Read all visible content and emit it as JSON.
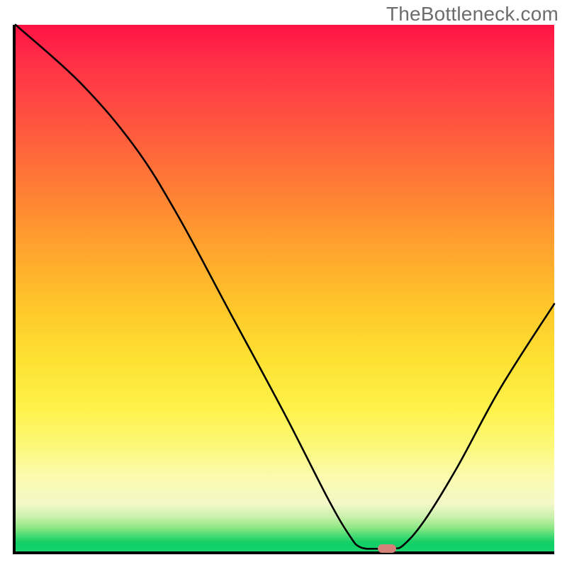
{
  "watermark": "TheBottleneck.com",
  "colors": {
    "axis": "#000000",
    "curve": "#000000",
    "marker": "#d58079",
    "gradient_top": "#ff1244",
    "gradient_bottom": "#18d66d"
  },
  "chart_data": {
    "type": "line",
    "title": "",
    "xlabel": "",
    "ylabel": "",
    "xlim": [
      0,
      100
    ],
    "ylim": [
      0,
      100
    ],
    "grid": false,
    "curve_points": [
      {
        "x": 0,
        "y": 100
      },
      {
        "x": 12,
        "y": 89
      },
      {
        "x": 22,
        "y": 77
      },
      {
        "x": 30,
        "y": 64
      },
      {
        "x": 40,
        "y": 45
      },
      {
        "x": 50,
        "y": 26
      },
      {
        "x": 58,
        "y": 10
      },
      {
        "x": 62,
        "y": 3
      },
      {
        "x": 64,
        "y": 0.8
      },
      {
        "x": 67,
        "y": 0.5
      },
      {
        "x": 70,
        "y": 0.6
      },
      {
        "x": 72,
        "y": 1.2
      },
      {
        "x": 76,
        "y": 6
      },
      {
        "x": 82,
        "y": 16
      },
      {
        "x": 90,
        "y": 31
      },
      {
        "x": 100,
        "y": 47
      }
    ],
    "marker": {
      "x": 69,
      "y": 0.5
    },
    "annotations": []
  }
}
